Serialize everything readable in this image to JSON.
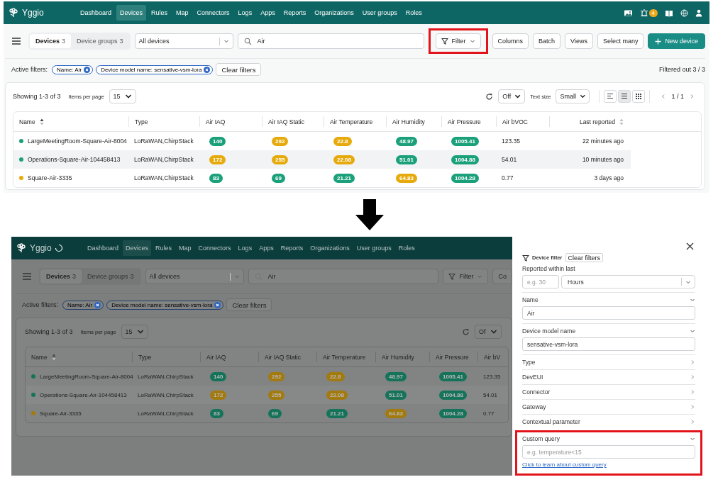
{
  "before": {
    "nav": {
      "brand": "Yggio",
      "loading": false,
      "alerts": "4",
      "items": [
        {
          "label": "Dashboard",
          "selected": false
        },
        {
          "label": "Devices",
          "selected": true
        },
        {
          "label": "Rules",
          "selected": false
        },
        {
          "label": "Map",
          "selected": false
        },
        {
          "label": "Connectors",
          "selected": false
        },
        {
          "label": "Logs",
          "selected": false
        },
        {
          "label": "Apps",
          "selected": false
        },
        {
          "label": "Reports",
          "selected": false
        },
        {
          "label": "Organizations",
          "selected": false
        },
        {
          "label": "User groups",
          "selected": false
        },
        {
          "label": "Roles",
          "selected": false
        }
      ]
    },
    "toolbar": {
      "tabs": [
        {
          "label": "Devices",
          "count": "3",
          "selected": true
        },
        {
          "label": "Device groups",
          "count": "3",
          "selected": false
        }
      ],
      "scope": "All devices",
      "search": "Air",
      "buttons": [
        {
          "label": "Filter",
          "kind": "filter",
          "highlighted": true
        },
        {
          "label": "Columns",
          "kind": "plain",
          "highlighted": false
        },
        {
          "label": "Batch",
          "kind": "plain",
          "highlighted": false
        },
        {
          "label": "Views",
          "kind": "plain",
          "highlighted": false
        },
        {
          "label": "Select many",
          "kind": "plain",
          "highlighted": false
        },
        {
          "label": "New device",
          "kind": "primary",
          "highlighted": false
        }
      ]
    },
    "active_filters": {
      "label": "Active filters:",
      "chips": [
        "Name: Air",
        "Device model name: sensative-vsm-lora"
      ],
      "clear": "Clear filters",
      "summary": "Filtered out 3 / 3"
    },
    "table_controls": {
      "showing": "Showing 1-3 of 3",
      "per_page_label": "Items per page",
      "per_page": "15",
      "auto_refresh": "Off",
      "text_size_label": "Text size",
      "text_size": "Small",
      "views": [
        {
          "kind": "text",
          "selected": false
        },
        {
          "kind": "list",
          "selected": true
        },
        {
          "kind": "grid",
          "selected": false
        }
      ],
      "page": "1 / 1"
    },
    "columns": [
      {
        "label": "Name",
        "sorted": true
      },
      {
        "label": "Type"
      },
      {
        "label": "Air IAQ"
      },
      {
        "label": "Air IAQ Static"
      },
      {
        "label": "Air Temperature"
      },
      {
        "label": "Air Humidity"
      },
      {
        "label": "Air Pressure"
      },
      {
        "label": "Air bVOC"
      },
      {
        "label": "Last reported",
        "sorted": false
      }
    ],
    "rows": [
      {
        "color": "#1aa07a",
        "name": "LargeMeetingRoom-Square-Air-8004",
        "type": "LoRaWAN,ChirpStack",
        "hovered": false,
        "readings": [
          {
            "value": "140",
            "color": "#1aa07a"
          },
          {
            "value": "292",
            "color": "#e6aa0c"
          },
          {
            "value": "22.8",
            "color": "#e6aa0c"
          },
          {
            "value": "48.97",
            "color": "#1aa07a"
          },
          {
            "value": "1005.41",
            "color": "#1aa07a"
          }
        ],
        "bvoc": "123.35",
        "last_reported": "22 minutes ago"
      },
      {
        "color": "#1aa07a",
        "name": "Operations-Square-Air-104458413",
        "type": "LoRaWAN,ChirpStack",
        "hovered": true,
        "readings": [
          {
            "value": "172",
            "color": "#e6aa0c"
          },
          {
            "value": "255",
            "color": "#e6aa0c"
          },
          {
            "value": "22.08",
            "color": "#e6aa0c"
          },
          {
            "value": "51.01",
            "color": "#1aa07a"
          },
          {
            "value": "1004.88",
            "color": "#1aa07a"
          }
        ],
        "bvoc": "54.01",
        "last_reported": "10 minutes ago"
      },
      {
        "color": "#e6aa0c",
        "name": "Square-Air-3335",
        "type": "LoRaWAN,ChirpStack",
        "hovered": false,
        "readings": [
          {
            "value": "83",
            "color": "#1aa07a"
          },
          {
            "value": "69",
            "color": "#1aa07a"
          },
          {
            "value": "21.21",
            "color": "#1aa07a"
          },
          {
            "value": "64.83",
            "color": "#e6aa0c"
          },
          {
            "value": "1004.28",
            "color": "#1aa07a"
          }
        ],
        "bvoc": "0.77",
        "last_reported": "3 days ago"
      }
    ]
  },
  "after": {
    "backdrop": true,
    "nav": {
      "brand": "Yggio",
      "loading": true,
      "items": [
        {
          "label": "Dashboard",
          "selected": false
        },
        {
          "label": "Devices",
          "selected": true
        },
        {
          "label": "Rules",
          "selected": false
        },
        {
          "label": "Map",
          "selected": false
        },
        {
          "label": "Connectors",
          "selected": false
        },
        {
          "label": "Logs",
          "selected": false
        },
        {
          "label": "Apps",
          "selected": false
        },
        {
          "label": "Reports",
          "selected": false
        },
        {
          "label": "Organizations",
          "selected": false
        },
        {
          "label": "User groups",
          "selected": false
        },
        {
          "label": "Roles",
          "selected": false
        }
      ]
    },
    "toolbar": {
      "tabs": [
        {
          "label": "Devices",
          "count": "3",
          "selected": true
        },
        {
          "label": "Device groups",
          "count": "3",
          "selected": false
        }
      ],
      "scope": "All devices",
      "search": "Air",
      "buttons": [
        {
          "label": "Filter",
          "kind": "filter",
          "highlighted": false
        },
        {
          "label": "Co",
          "kind": "plain",
          "highlighted": false
        }
      ]
    },
    "active_filters": {
      "label": "Active filters:",
      "chips": [
        "Name: Air",
        "Device model name: sensative-vsm-lora"
      ],
      "clear": "Clear filters"
    },
    "table_controls": {
      "showing": "Showing 1-3 of 3",
      "per_page_label": "Items per page",
      "per_page": "15",
      "auto_refresh": "Of"
    },
    "columns": [
      {
        "label": "Name",
        "sorted": true
      },
      {
        "label": "Type"
      },
      {
        "label": "Air IAQ"
      },
      {
        "label": "Air IAQ Static"
      },
      {
        "label": "Air Temperature"
      },
      {
        "label": "Air Humidity"
      },
      {
        "label": "Air Pressure"
      },
      {
        "label": "Air bV"
      }
    ],
    "rows": [
      {
        "color": "#15735a",
        "name": "LargeMeetingRoom-Square-Air-8004",
        "type": "LoRaWAN,ChirpStack",
        "hovered": false,
        "readings": [
          {
            "value": "140",
            "color": "#15735a"
          },
          {
            "value": "292",
            "color": "#a27a0e"
          },
          {
            "value": "22.8",
            "color": "#a27a0e"
          },
          {
            "value": "48.97",
            "color": "#15735a"
          },
          {
            "value": "1005.41",
            "color": "#15735a"
          }
        ],
        "bvoc": "123.35"
      },
      {
        "color": "#15735a",
        "name": "Operations-Square-Air-104458413",
        "type": "LoRaWAN,ChirpStack",
        "hovered": true,
        "readings": [
          {
            "value": "172",
            "color": "#a27a0e"
          },
          {
            "value": "255",
            "color": "#a27a0e"
          },
          {
            "value": "22.08",
            "color": "#a27a0e"
          },
          {
            "value": "51.01",
            "color": "#15735a"
          },
          {
            "value": "1004.88",
            "color": "#15735a"
          }
        ],
        "bvoc": "54.01"
      },
      {
        "color": "#a27a0e",
        "name": "Square-Air-3335",
        "type": "LoRaWAN,ChirpStack",
        "hovered": false,
        "readings": [
          {
            "value": "83",
            "color": "#15735a"
          },
          {
            "value": "69",
            "color": "#15735a"
          },
          {
            "value": "21.21",
            "color": "#15735a"
          },
          {
            "value": "64.83",
            "color": "#a27a0e"
          },
          {
            "value": "1004.28",
            "color": "#15735a"
          }
        ],
        "bvoc": "0.77"
      }
    ],
    "drawer": {
      "title": "Device filter",
      "clear": "Clear filters",
      "sections": [
        {
          "kind": "range",
          "label": "Reported within last",
          "placeholder": "e.g. 30",
          "unit": "Hours",
          "highlighted": false
        },
        {
          "kind": "text",
          "label": "Name",
          "expanded": true,
          "value": "Air",
          "highlighted": false
        },
        {
          "kind": "text",
          "label": "Device model name",
          "expanded": true,
          "value": "sensative-vsm-lora",
          "highlighted": false
        },
        {
          "kind": "text",
          "label": "Type",
          "expanded": false,
          "highlighted": false
        },
        {
          "kind": "text",
          "label": "DevEUI",
          "expanded": false,
          "highlighted": false
        },
        {
          "kind": "text",
          "label": "Connector",
          "expanded": false,
          "highlighted": false
        },
        {
          "kind": "text",
          "label": "Gateway",
          "expanded": false,
          "highlighted": false
        },
        {
          "kind": "text",
          "label": "Contextual parameter",
          "expanded": false,
          "highlighted": false
        },
        {
          "kind": "query",
          "label": "Custom query",
          "expanded": true,
          "placeholder": "e.g. temperature<15",
          "link": "Click to learn about custom query",
          "highlighted": true
        }
      ]
    }
  }
}
